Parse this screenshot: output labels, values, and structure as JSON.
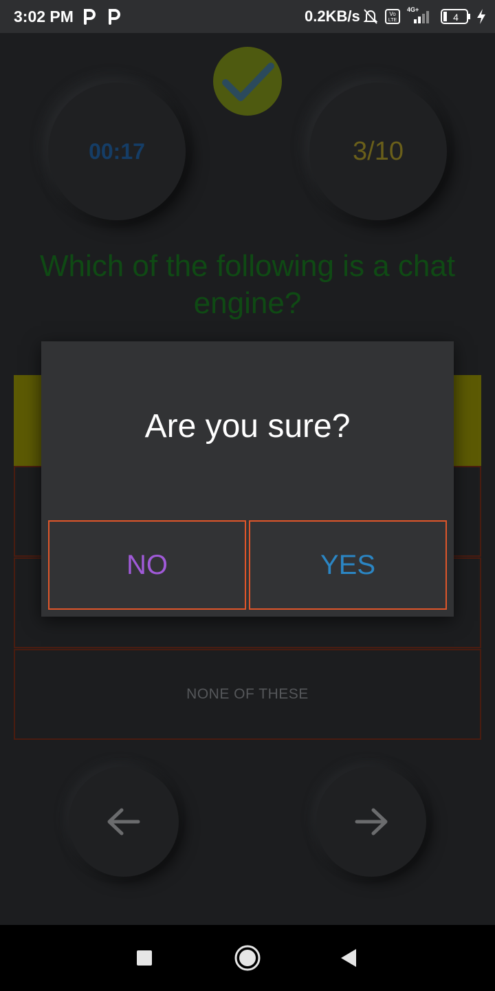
{
  "status_bar": {
    "time": "3:02 PM",
    "speed": "0.2KB/s",
    "network_type": "4G+",
    "volte": "Vo LTE",
    "battery": "4"
  },
  "quiz": {
    "timer": "00:17",
    "progress": "3/10",
    "question": "Which of the following is a chat engine?",
    "options": [
      "",
      "",
      "",
      "NONE OF THESE"
    ]
  },
  "dialog": {
    "title": "Are you sure?",
    "no_label": "NO",
    "yes_label": "YES"
  },
  "colors": {
    "accent_border": "#e0562a",
    "no_text": "#a05ad8",
    "yes_text": "#2b86c4",
    "selected_option": "#5c5a04",
    "question_text": "#0f4a14"
  }
}
